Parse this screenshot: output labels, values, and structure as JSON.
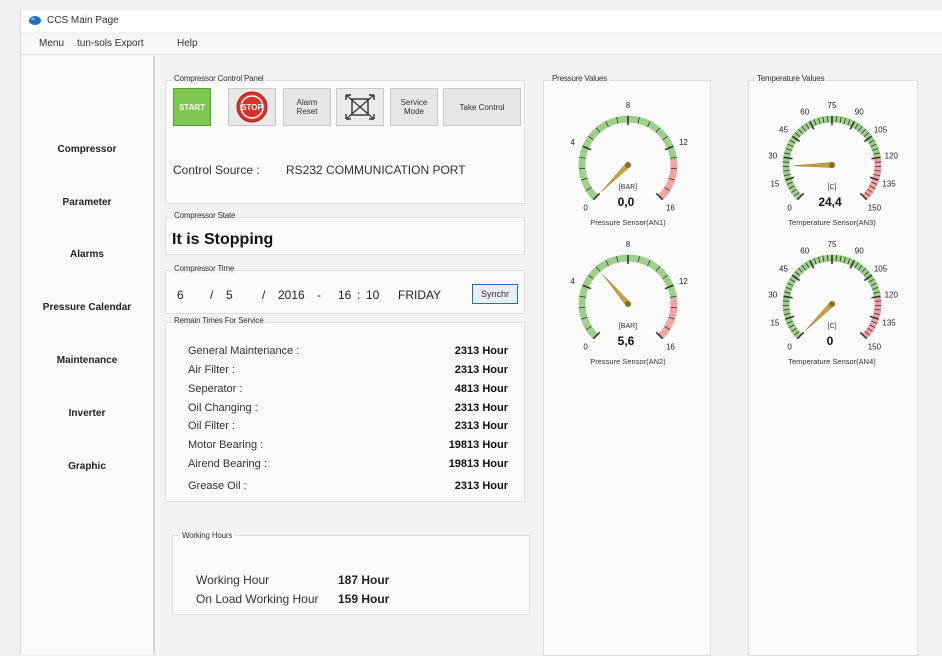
{
  "window": {
    "title": "CCS Main Page"
  },
  "menu": {
    "items": [
      "Menu",
      "tun-sols Export",
      "Help"
    ]
  },
  "sidebar": {
    "items": [
      "Compressor",
      "Parameter",
      "Alarms",
      "Pressure Calendar",
      "Maintenance",
      "Inverter",
      "Graphic"
    ]
  },
  "control_panel": {
    "title": "Compressor Control Panel",
    "start": "START",
    "stop": "STOP",
    "alarm_reset": "Alarm Reset",
    "service_mode": "Service Mode",
    "take_control": "Take Control",
    "source_label": "Control Source :",
    "source_value": "RS232 COMMUNICATION PORT"
  },
  "state": {
    "title": "Compressor State",
    "value": "It is Stopping"
  },
  "time": {
    "title": "Compressor Time",
    "day": "6",
    "sep1": "/",
    "month": "5",
    "sep2": "/",
    "year": "2016",
    "dash": "-",
    "hour": "16",
    "colon": ":",
    "minute": "10",
    "weekday": "FRIDAY",
    "sync": "Synchr"
  },
  "service": {
    "title": "Remain Times For Service",
    "rows": [
      {
        "label": "General Maintenance :",
        "value": "2313 Hour"
      },
      {
        "label": "Air Filter :",
        "value": "2313 Hour"
      },
      {
        "label": "Seperator :",
        "value": "4813 Hour"
      },
      {
        "label": "Oil Changing :",
        "value": "2313 Hour"
      },
      {
        "label": "Oil Filter :",
        "value": "2313 Hour"
      },
      {
        "label": "Motor Bearing :",
        "value": "19813 Hour"
      },
      {
        "label": "Airend Bearing :",
        "value": "19813 Hour"
      },
      {
        "label": "Grease Oil :",
        "value": "2313 Hour"
      }
    ]
  },
  "working": {
    "title": "Working Hours",
    "rows": [
      {
        "label": "Working Hour",
        "value": "187 Hour"
      },
      {
        "label": "On Load Working Hour",
        "value": "159 Hour"
      }
    ]
  },
  "pressure": {
    "title": "Pressure Values",
    "gauges": [
      {
        "unit": "[BAR]",
        "value": 0.0,
        "display": "0,0",
        "caption": "Pressure Sensor(AN1)",
        "min": 0,
        "max": 16,
        "ticks": [
          "0",
          "4",
          "8",
          "12",
          "16"
        ]
      },
      {
        "unit": "[BAR]",
        "value": 5.6,
        "display": "5,6",
        "caption": "Pressure Sensor(AN2)",
        "min": 0,
        "max": 16,
        "ticks": [
          "0",
          "4",
          "8",
          "12",
          "16"
        ]
      }
    ]
  },
  "temperature": {
    "title": "Temperature Values",
    "gauges": [
      {
        "unit": "[C]",
        "value": 24.4,
        "display": "24,4",
        "caption": "Temperature Sensor(AN3)",
        "min": 0,
        "max": 150,
        "ticks": [
          "0",
          "15",
          "30",
          "45",
          "60",
          "75",
          "90",
          "105",
          "120",
          "135",
          "150"
        ]
      },
      {
        "unit": "[C]",
        "value": 0,
        "display": "0",
        "caption": "Temperature Sensor(AN4)",
        "min": 0,
        "max": 150,
        "ticks": [
          "0",
          "15",
          "30",
          "45",
          "60",
          "75",
          "90",
          "105",
          "120",
          "135",
          "150"
        ]
      }
    ]
  },
  "colors": {
    "start": "#7ec850",
    "stop": "#d9302a",
    "gauge_green": "#9fd08a",
    "gauge_red": "#f2a3a3",
    "needle": "#c8a23a",
    "accent": "#1f6fc4"
  }
}
